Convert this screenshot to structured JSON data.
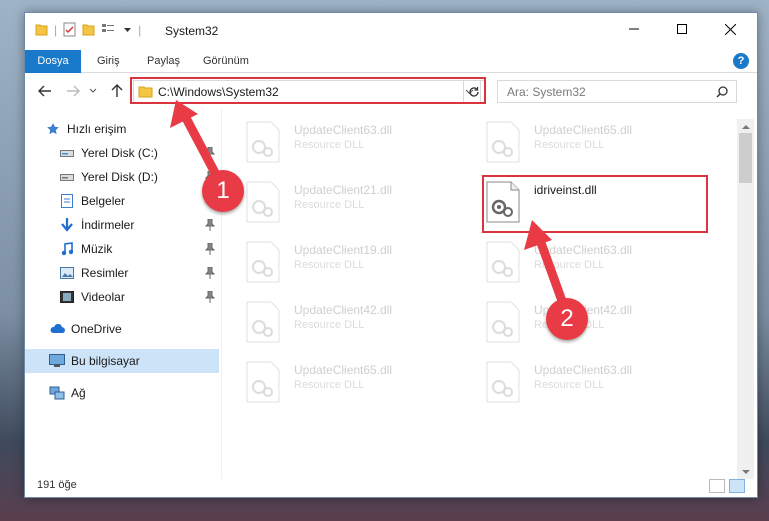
{
  "window": {
    "title": "System32",
    "controls": {
      "minimize": "—",
      "maximize": "☐",
      "close": "✕"
    }
  },
  "ribbon": {
    "tabs": [
      {
        "label": "Dosya",
        "active": true
      },
      {
        "label": "Giriş"
      },
      {
        "label": "Paylaş"
      },
      {
        "label": "Görünüm"
      }
    ],
    "help": "?"
  },
  "address": {
    "path": "C:\\Windows\\System32",
    "search_placeholder": "Ara: System32"
  },
  "nav": {
    "items": [
      {
        "label": "Hızlı erişim",
        "icon": "star-icon",
        "pinned": false
      },
      {
        "label": "Yerel Disk (C:)",
        "icon": "drive-icon",
        "pinned": true
      },
      {
        "label": "Yerel Disk (D:)",
        "icon": "drive-icon",
        "pinned": true
      },
      {
        "label": "Belgeler",
        "icon": "documents-icon",
        "pinned": true
      },
      {
        "label": "İndirmeler",
        "icon": "download-icon",
        "pinned": true
      },
      {
        "label": "Müzik",
        "icon": "music-icon",
        "pinned": true
      },
      {
        "label": "Resimler",
        "icon": "pictures-icon",
        "pinned": true
      },
      {
        "label": "Videolar",
        "icon": "video-icon",
        "pinned": true
      },
      {
        "label": "OneDrive",
        "icon": "cloud-icon",
        "pinned": false
      },
      {
        "label": "Bu bilgisayar",
        "icon": "computer-icon",
        "pinned": false,
        "selected": true
      },
      {
        "label": "Ağ",
        "icon": "network-icon",
        "pinned": false
      }
    ]
  },
  "files": {
    "left": [
      {
        "name": "UpdateClient63.dll",
        "desc": "Resource DLL"
      },
      {
        "name": "UpdateClient21.dll",
        "desc": "Resource DLL"
      },
      {
        "name": "UpdateClient19.dll",
        "desc": "Resource DLL"
      },
      {
        "name": "UpdateClient42.dll",
        "desc": "Resource DLL"
      },
      {
        "name": "UpdateClient65.dll",
        "desc": "Resource DLL"
      }
    ],
    "right": [
      {
        "name": "UpdateClient65.dll",
        "desc": "Resource DLL"
      },
      {
        "name": "idriveinst.dll",
        "desc": "",
        "highlighted": true
      },
      {
        "name": "UpdateClient63.dll",
        "desc": "Resource DLL"
      },
      {
        "name": "UpdateClient42.dll",
        "desc": "Resource DLL"
      },
      {
        "name": "UpdateClient63.dll",
        "desc": "Resource DLL"
      }
    ]
  },
  "status": {
    "count": "191 öğe"
  },
  "annotations": {
    "callout1": "1",
    "callout2": "2",
    "color": "#e83b46"
  }
}
